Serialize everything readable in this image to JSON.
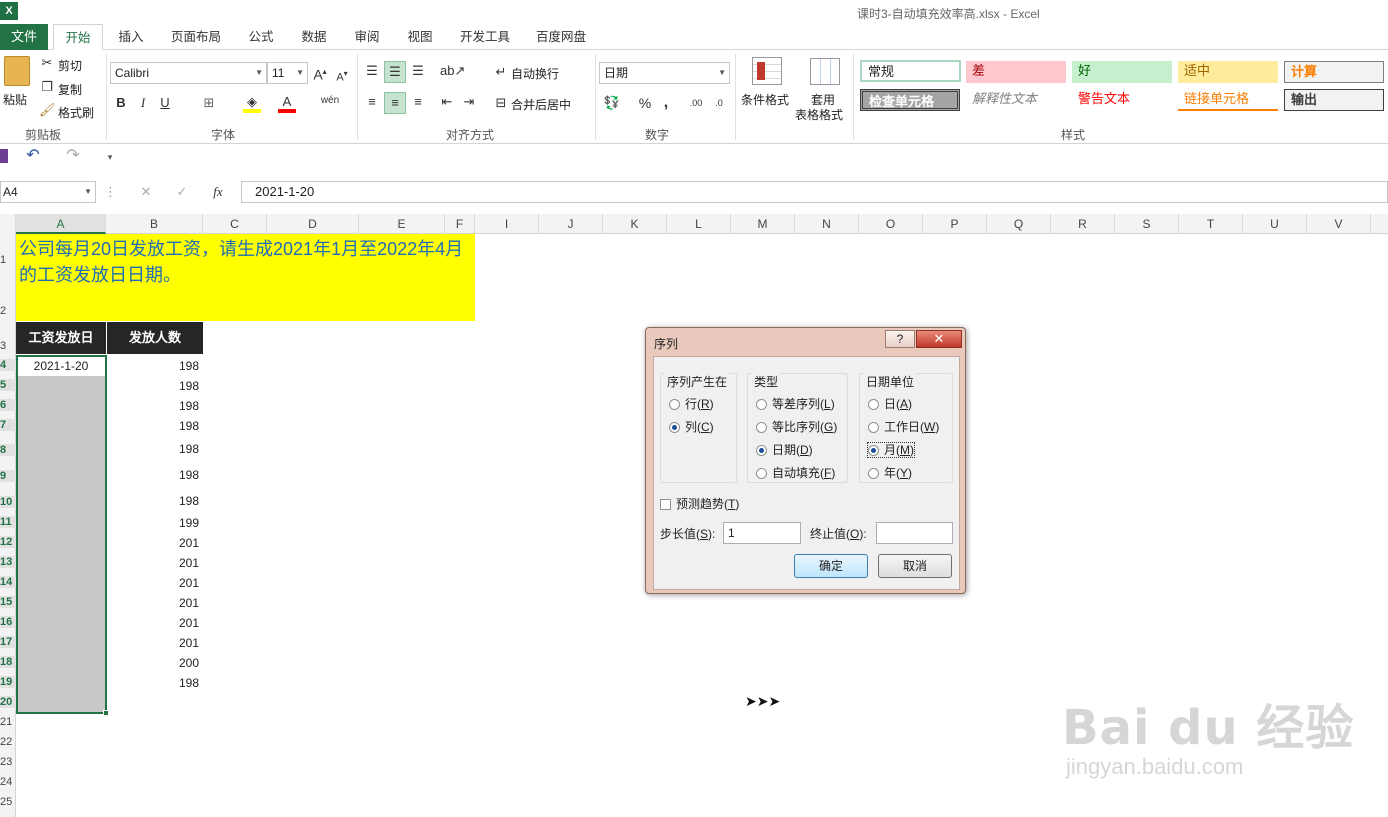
{
  "title_bar": {
    "app_icon_letter": "X",
    "document_title": "课时3-自动填充效率高.xlsx - Excel"
  },
  "tabs": {
    "file": "文件",
    "items": [
      "开始",
      "插入",
      "页面布局",
      "公式",
      "数据",
      "审阅",
      "视图",
      "开发工具",
      "百度网盘"
    ],
    "active_index": 0
  },
  "ribbon": {
    "clipboard": {
      "paste": "粘贴",
      "cut": "剪切",
      "copy": "复制",
      "format_painter": "格式刷",
      "label": "剪贴板"
    },
    "font": {
      "name": "Calibri",
      "size": "11",
      "bold": "B",
      "italic": "I",
      "underline": "U",
      "label": "字体"
    },
    "alignment": {
      "wrap_text": "自动换行",
      "merge_center": "合并后居中",
      "label": "对齐方式"
    },
    "number": {
      "format": "日期",
      "percent": "%",
      "comma": ",",
      "label": "数字"
    },
    "styles_group": {
      "conditional_formatting": "条件格式",
      "format_as_table_line1": "套用",
      "format_as_table_line2": "表格格式",
      "label": "样式"
    },
    "cell_styles": [
      {
        "label": "常规",
        "bg": "#ffffff",
        "color": "#000000"
      },
      {
        "label": "差",
        "bg": "#ffc7ce",
        "color": "#9c0006"
      },
      {
        "label": "好",
        "bg": "#c6efce",
        "color": "#006100"
      },
      {
        "label": "适中",
        "bg": "#ffeb9c",
        "color": "#9c6500"
      },
      {
        "label": "计算",
        "bg": "#f2f2f2",
        "color": "#fa7d00"
      },
      {
        "label": "检查单元格",
        "bg": "#a5a5a5",
        "color": "#ffffff"
      },
      {
        "label": "解释性文本",
        "bg": "#ffffff",
        "color": "#7f7f7f"
      },
      {
        "label": "警告文本",
        "bg": "#ffffff",
        "color": "#ff0000"
      },
      {
        "label": "链接单元格",
        "bg": "#ffffff",
        "color": "#fa7d00"
      },
      {
        "label": "输出",
        "bg": "#f2f2f2",
        "color": "#3f3f3f"
      }
    ]
  },
  "formula_bar": {
    "name_box": "A4",
    "fx": "fx",
    "value": "2021-1-20"
  },
  "columns": [
    "A",
    "B",
    "C",
    "D",
    "E",
    "F",
    "I",
    "J",
    "K",
    "L",
    "M",
    "N",
    "O",
    "P",
    "Q",
    "R",
    "S",
    "T",
    "U",
    "V"
  ],
  "row_numbers": [
    "1",
    "2",
    "3",
    "4",
    "5",
    "6",
    "7",
    "8",
    "9",
    "10",
    "11",
    "12",
    "13",
    "14",
    "15",
    "16",
    "17",
    "18",
    "19",
    "20",
    "21",
    "22",
    "23",
    "24",
    "25"
  ],
  "sheet": {
    "banner_text": "公司每月20日发放工资，请生成2021年1月至2022年4月的工资发放日日期。",
    "header_a": "工资发放日",
    "header_b": "发放人数",
    "a4": "2021-1-20",
    "b_values": [
      "198",
      "198",
      "198",
      "198",
      "198",
      "198",
      "198",
      "199",
      "201",
      "201",
      "201",
      "201",
      "201",
      "201",
      "200",
      "198"
    ]
  },
  "dialog": {
    "title": "序列",
    "help": "?",
    "close": "✕",
    "series_in": {
      "title": "序列产生在",
      "row": "行(",
      "row_key": "R",
      "col": "列(",
      "col_key": "C",
      "selected": "列"
    },
    "type": {
      "title": "类型",
      "linear": "等差序列(",
      "linear_key": "L",
      "growth": "等比序列(",
      "growth_key": "G",
      "date": "日期(",
      "date_key": "D",
      "autofill": "自动填充(",
      "autofill_key": "F",
      "selected": "日期"
    },
    "date_unit": {
      "title": "日期单位",
      "day": "日(",
      "day_key": "A",
      "weekday": "工作日(",
      "weekday_key": "W",
      "month": "月(",
      "month_key": "M",
      "year": "年(",
      "year_key": "Y",
      "selected": "月"
    },
    "trend": "预测趋势(",
    "trend_key": "T",
    "step_label": "步长值(",
    "step_key": "S",
    "step_value": "1",
    "stop_label": "终止值(",
    "stop_key": "O",
    "stop_value": "",
    "ok": "确定",
    "cancel": "取消"
  },
  "overlay": {
    "arrows": "➤➤➤",
    "watermark_main": "Bai du 经验",
    "watermark_sub": "jingyan.baidu.com"
  }
}
